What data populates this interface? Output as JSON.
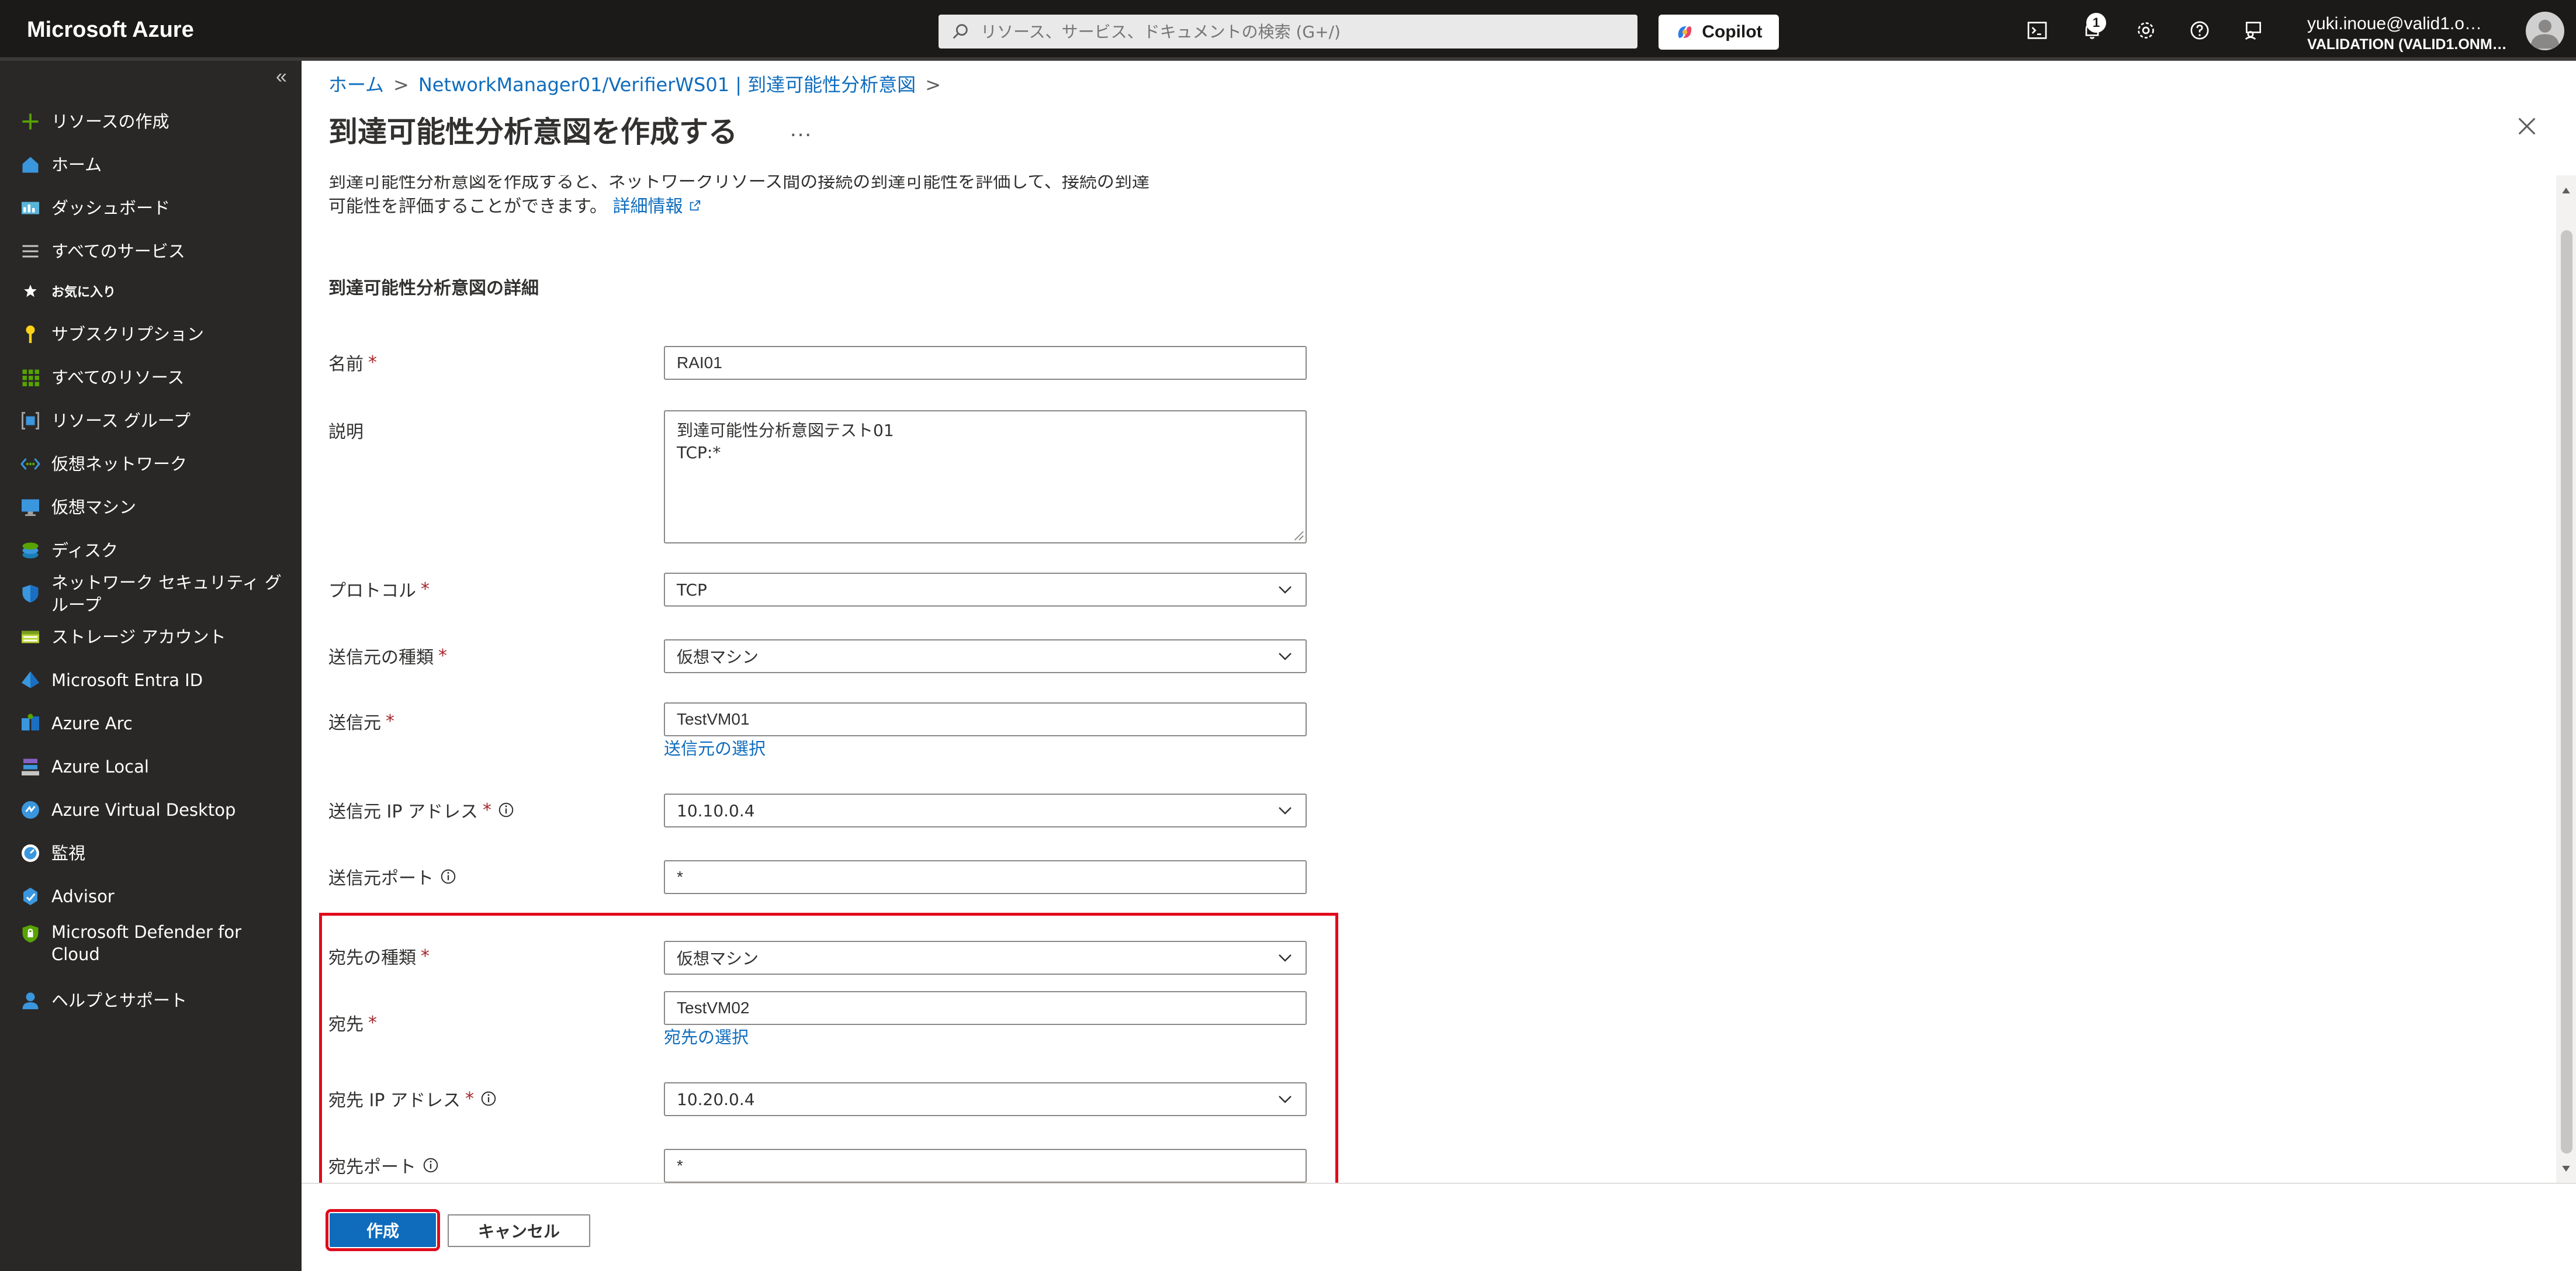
{
  "topbar": {
    "brand": "Microsoft Azure",
    "search_placeholder": "リソース、サービス、ドキュメントの検索 (G+/)",
    "copilot_label": "Copilot",
    "notification_count": "1",
    "user_name": "yuki.inoue@valid1.o…",
    "user_directory": "VALIDATION (VALID1.ONM…",
    "icons": [
      "cloud-shell-icon",
      "notifications-icon",
      "settings-icon",
      "help-icon",
      "feedback-icon"
    ]
  },
  "sidebar": {
    "collapse": "«",
    "create_resource": "リソースの作成",
    "home": "ホーム",
    "dashboard": "ダッシュボード",
    "all_services": "すべてのサービス",
    "favorites_header": "お気に入り",
    "items": [
      {
        "label": "サブスクリプション",
        "icon": "key-icon"
      },
      {
        "label": "すべてのリソース",
        "icon": "grid-icon"
      },
      {
        "label": "リソース グループ",
        "icon": "resource-group-icon"
      },
      {
        "label": "仮想ネットワーク",
        "icon": "vnet-icon"
      },
      {
        "label": "仮想マシン",
        "icon": "vm-icon"
      },
      {
        "label": "ディスク",
        "icon": "disk-icon"
      },
      {
        "label": "ネットワーク セキュリティ グループ",
        "icon": "shield-icon"
      },
      {
        "label": "ストレージ アカウント",
        "icon": "storage-icon"
      },
      {
        "label": "Microsoft Entra ID",
        "icon": "entra-icon"
      },
      {
        "label": "Azure Arc",
        "icon": "arc-icon"
      },
      {
        "label": "Azure Local",
        "icon": "azure-local-icon"
      },
      {
        "label": "Azure Virtual Desktop",
        "icon": "avd-icon"
      },
      {
        "label": "監視",
        "icon": "monitor-icon"
      },
      {
        "label": "Advisor",
        "icon": "advisor-icon"
      },
      {
        "label": "Microsoft Defender for Cloud",
        "icon": "defender-icon"
      },
      {
        "label": "ヘルプとサポート",
        "icon": "support-icon"
      }
    ]
  },
  "breadcrumb": {
    "home": "ホーム",
    "parent": "NetworkManager01/VerifierWS01 | 到達可能性分析意図",
    "sep": ">"
  },
  "page": {
    "title": "到達可能性分析意図を作成する",
    "more": "…",
    "intro_cut": "到達可能性分析意図を作成すると、ネットワークリソース間の接続の到達可能性を評価して、接続の到達",
    "intro": "可能性を評価することができます。",
    "learn_more": "詳細情報",
    "section_title": "到達可能性分析意図の詳細"
  },
  "form": {
    "name": {
      "label": "名前",
      "required": "*",
      "value": "RAI01"
    },
    "description": {
      "label": "説明",
      "line1": "到達可能性分析意図テスト01",
      "line2": "TCP:*"
    },
    "protocol": {
      "label": "プロトコル",
      "required": "*",
      "value": "TCP"
    },
    "source_type": {
      "label": "送信元の種類",
      "required": "*",
      "value": "仮想マシン"
    },
    "source": {
      "label": "送信元",
      "required": "*",
      "value": "TestVM01",
      "link": "送信元の選択"
    },
    "source_ip": {
      "label": "送信元 IP アドレス",
      "required": "*",
      "value": "10.10.0.4"
    },
    "source_port": {
      "label": "送信元ポート",
      "value": "*"
    },
    "dest_type": {
      "label": "宛先の種類",
      "required": "*",
      "value": "仮想マシン"
    },
    "dest": {
      "label": "宛先",
      "required": "*",
      "value": "TestVM02",
      "link": "宛先の選択"
    },
    "dest_ip": {
      "label": "宛先 IP アドレス",
      "required": "*",
      "value": "10.20.0.4"
    },
    "dest_port": {
      "label": "宛先ポート",
      "value": "*"
    }
  },
  "footer": {
    "create": "作成",
    "cancel": "キャンセル"
  },
  "colors": {
    "accent": "#0f6cbd",
    "highlight": "#e00b1c",
    "required": "#a4262c",
    "topbar": "#1b1a19",
    "sidebar": "#292827"
  }
}
